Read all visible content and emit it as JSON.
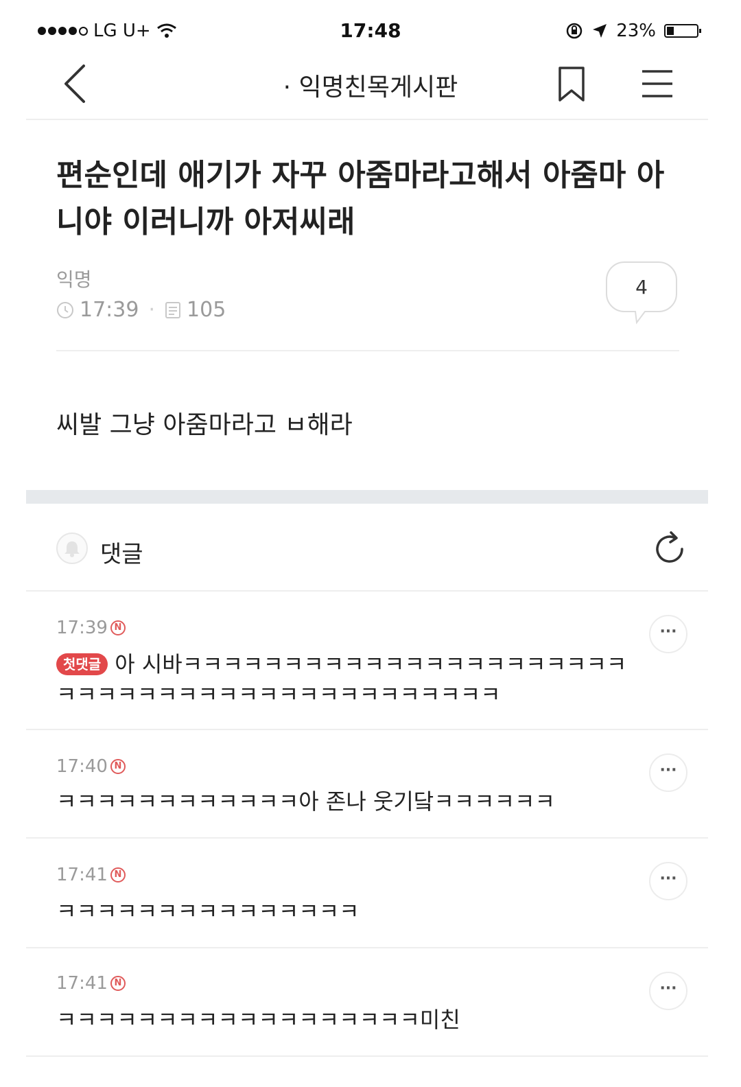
{
  "status_bar": {
    "carrier": "LG U+",
    "time": "17:48",
    "battery": "23%",
    "icons": [
      "signal-dots-icon",
      "wifi-icon",
      "rotation-lock-icon",
      "location-arrow-icon",
      "battery-icon"
    ]
  },
  "header": {
    "title": "· 익명친목게시판",
    "icons": [
      "back-chevron-icon",
      "bookmark-icon",
      "hamburger-menu-icon"
    ]
  },
  "post": {
    "title": "편순인데 애기가 자꾸 아줌마라고해서 아줌마 아니야 이러니까 아저씨래",
    "author": "익명",
    "time": "17:39",
    "views": "105",
    "comment_count": "4",
    "body": "씨발 그냥 아줌마라고 ㅂ해라"
  },
  "comments_header": {
    "label": "댓글"
  },
  "comments": [
    {
      "time": "17:39",
      "new_badge": "N",
      "first_badge": "첫댓글",
      "text": "아 시바ㅋㅋㅋㅋㅋㅋㅋㅋㅋㅋㅋㅋㅋㅋㅋㅋㅋㅋㅋㅋㅋㅋㅋㅋㅋㅋㅋㅋㅋㅋㅋㅋㅋㅋㅋㅋㅋㅋㅋㅋㅋㅋㅋㅋ",
      "more": "···"
    },
    {
      "time": "17:40",
      "new_badge": "N",
      "text": "ㅋㅋㅋㅋㅋㅋㅋㅋㅋㅋㅋㅋ아 존나 웃기닼ㅋㅋㅋㅋㅋㅋ",
      "more": "···"
    },
    {
      "time": "17:41",
      "new_badge": "N",
      "text": "ㅋㅋㅋㅋㅋㅋㅋㅋㅋㅋㅋㅋㅋㅋㅋ",
      "more": "···"
    },
    {
      "time": "17:41",
      "new_badge": "N",
      "text": "ㅋㅋㅋㅋㅋㅋㅋㅋㅋㅋㅋㅋㅋㅋㅋㅋㅋㅋ미친",
      "more": "···"
    }
  ]
}
